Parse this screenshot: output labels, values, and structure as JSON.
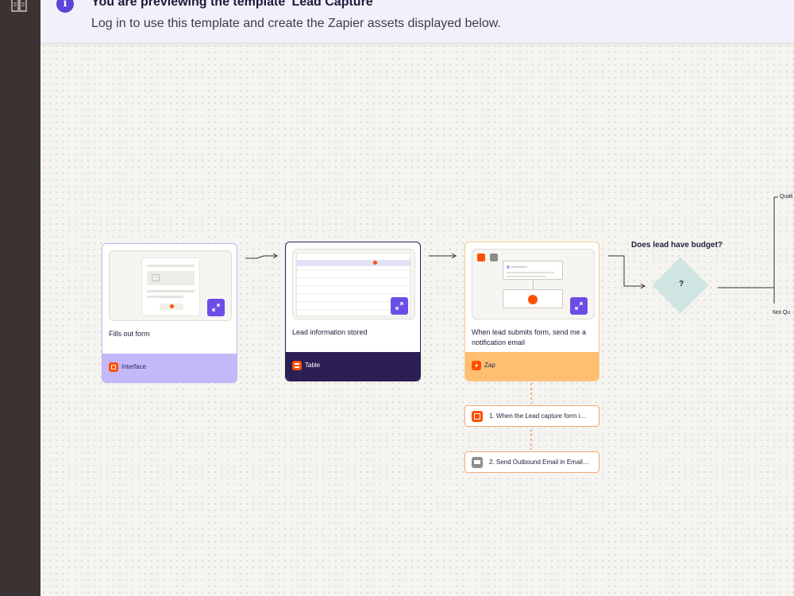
{
  "banner": {
    "title": "You are previewing the template 'Lead Capture'",
    "subtitle": "Log in to use this template and create the Zapier assets displayed below."
  },
  "cards": [
    {
      "label": "Fills out form",
      "footer_label": "Interface",
      "footer_color": "#c4b8fb",
      "border_color": "#c0b6f5",
      "footer_text_color": "#2b2358"
    },
    {
      "label": "Lead information stored",
      "footer_label": "Table",
      "footer_color": "#2b1f55",
      "border_color": "#2b1f55",
      "footer_text_color": "#ffffff"
    },
    {
      "label": "When lead submits form, send me a notification email",
      "footer_label": "Zap",
      "footer_color": "#ffbf70",
      "border_color": "#f7c891",
      "footer_text_color": "#2b2358"
    }
  ],
  "steps": [
    {
      "label": "1. When the Lead capture form i…",
      "icon": "interface-icon"
    },
    {
      "label": "2. Send Outbound Email in Email…",
      "icon": "email-icon"
    }
  ],
  "decision": {
    "title": "Does lead have budget?",
    "symbol": "?",
    "branches": [
      "Quali",
      "Not Qu"
    ]
  },
  "colors": {
    "accent": "#6b4ee6",
    "zapier_orange": "#ff4f00",
    "sidebar": "#3b3331",
    "diamond": "#cfe5e1"
  }
}
